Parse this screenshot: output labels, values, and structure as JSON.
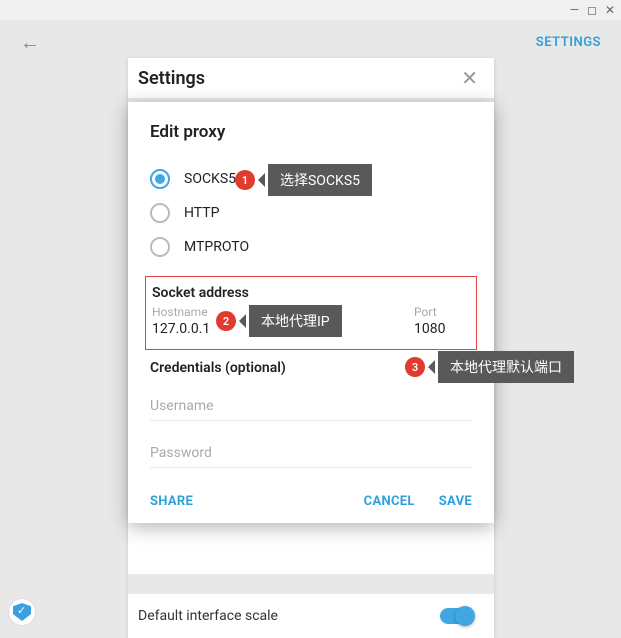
{
  "window": {
    "minimize": "—",
    "maximize": "◻",
    "close": "✕"
  },
  "topbar": {
    "settings": "SETTINGS"
  },
  "settings_panel": {
    "title": "Settings",
    "default_scale": "Default interface scale"
  },
  "dialog": {
    "title": "Edit proxy",
    "radios": {
      "socks5": "SOCKS5",
      "http": "HTTP",
      "mtproto": "MTPROTO"
    },
    "socket_header": "Socket address",
    "hostname_label": "Hostname",
    "hostname_value": "127.0.0.1",
    "port_label": "Port",
    "port_value": "1080",
    "credentials_header": "Credentials (optional)",
    "username_ph": "Username",
    "password_ph": "Password",
    "share": "SHARE",
    "cancel": "CANCEL",
    "save": "SAVE"
  },
  "callouts": {
    "c1": {
      "num": "1",
      "text": "选择SOCKS5"
    },
    "c2": {
      "num": "2",
      "text": "本地代理IP"
    },
    "c3": {
      "num": "3",
      "text": "本地代理默认端口"
    }
  }
}
